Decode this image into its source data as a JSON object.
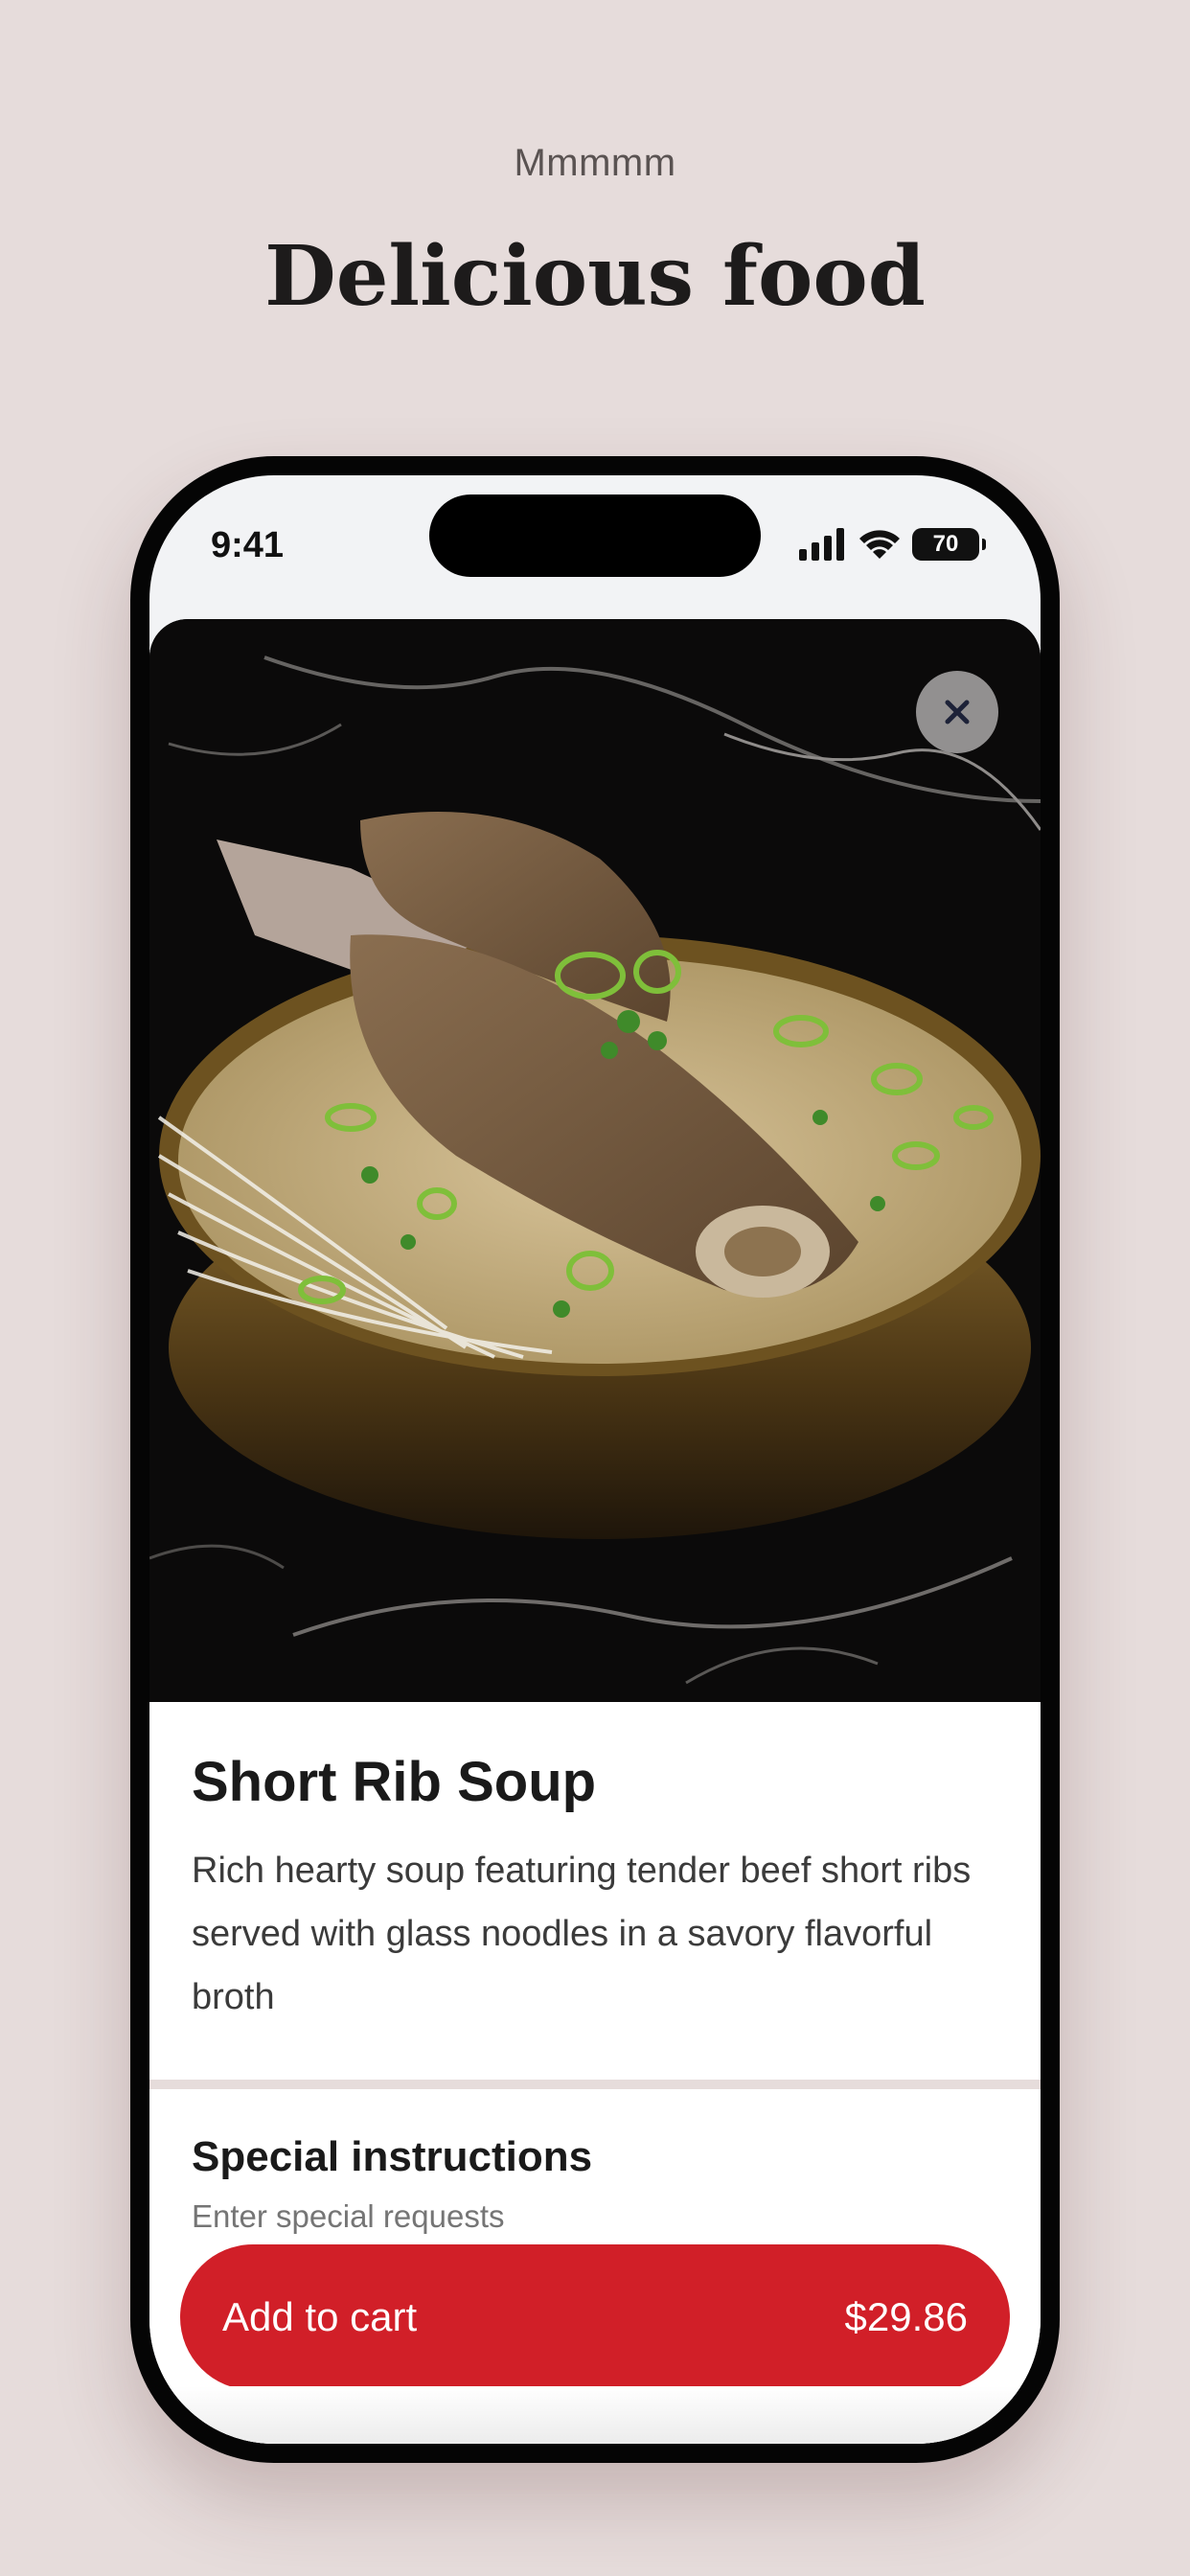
{
  "page": {
    "eyebrow": "Mmmmm",
    "headline": "Delicious food"
  },
  "status_bar": {
    "time": "9:41",
    "battery": "70"
  },
  "product": {
    "image_icon": "food-photo-short-rib-soup",
    "name": "Short Rib Soup",
    "description": "Rich hearty soup featuring tender beef short ribs served with glass noodles in a savory flavorful broth"
  },
  "instructions": {
    "title": "Special instructions",
    "placeholder": "Enter special requests"
  },
  "cart": {
    "label": "Add to cart",
    "price": "$29.86"
  },
  "colors": {
    "background": "#e6dcdb",
    "accent": "#d11f28"
  }
}
